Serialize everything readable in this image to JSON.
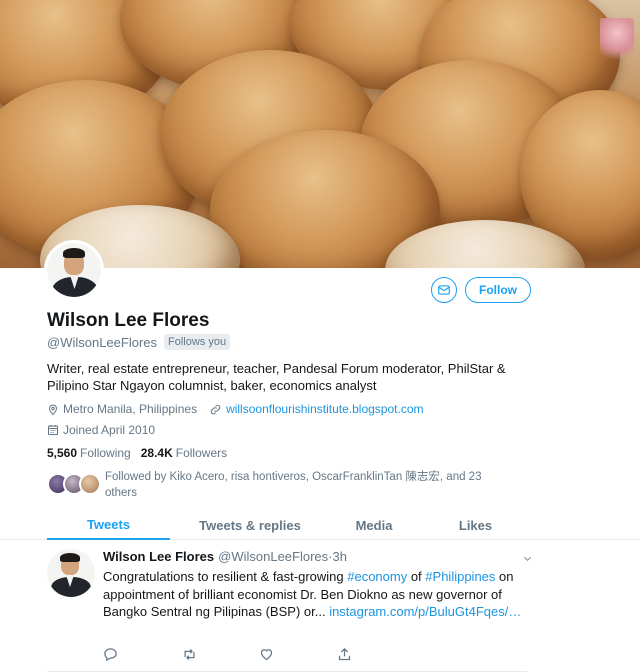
{
  "profile": {
    "name": "Wilson Lee Flores",
    "handle": "@WilsonLeeFlores",
    "follows_you": "Follows you",
    "bio": "Writer, real estate entrepreneur, teacher, Pandesal Forum moderator, PhilStar & Pilipino Star Ngayon columnist, baker, economics analyst",
    "location": "Metro Manila, Philippines",
    "website": "willsoonflourishinstitute.blogspot.com",
    "joined": "Joined April 2010",
    "following_count": "5,560",
    "following_label": "Following",
    "followers_count": "28.4K",
    "followers_label": "Followers",
    "followed_by": "Followed by Kiko Acero, risa hontiveros, OscarFranklinTan 陳志宏, and 23 others"
  },
  "actions": {
    "follow_label": "Follow",
    "message_icon": "envelope-icon"
  },
  "tabs": [
    {
      "label": "Tweets",
      "active": true
    },
    {
      "label": "Tweets & replies",
      "active": false
    },
    {
      "label": "Media",
      "active": false
    },
    {
      "label": "Likes",
      "active": false
    }
  ],
  "tweet": {
    "author": "Wilson Lee Flores",
    "handle": "@WilsonLeeFlores",
    "separator": "·",
    "time": "3h",
    "text_1": "Congratulations to resilient & fast-growing ",
    "hashtag_1": "#economy",
    "text_2": " of ",
    "hashtag_2": "#Philippines",
    "text_3": " on appointment of brilliant economist Dr. Ben Diokno as new governor of Bangko Sentral ng Pilipinas (BSP) or... ",
    "link": "instagram.com/p/BuluGt4Fqes/…"
  },
  "colors": {
    "accent": "#1da1f2",
    "link": "#1b95e0",
    "secondary_text": "#657786",
    "divider": "#e6ecf0"
  }
}
